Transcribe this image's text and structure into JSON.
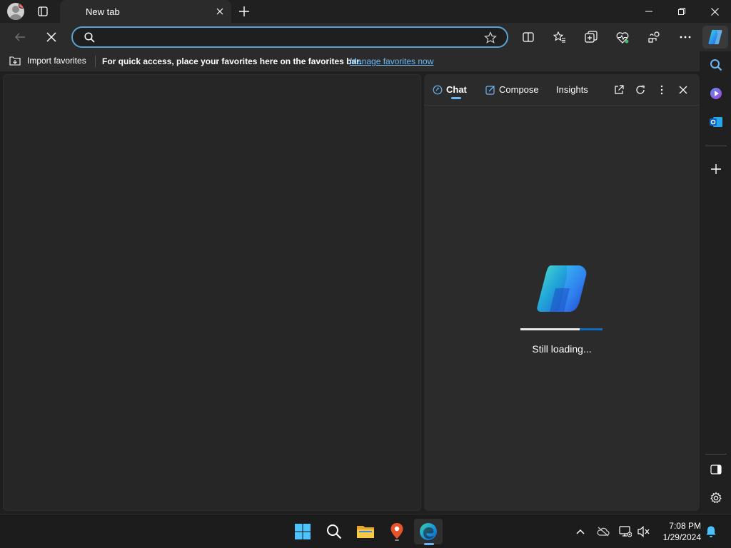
{
  "browser": {
    "tab": {
      "title": "New tab"
    },
    "address_bar": {
      "value": "",
      "placeholder": ""
    }
  },
  "favorites_bar": {
    "import_label": "Import favorites",
    "message": "For quick access, place your favorites here on the favorites bar.",
    "manage_link": "Manage favorites now"
  },
  "copilot_panel": {
    "tabs": [
      {
        "label": "Chat",
        "active": true
      },
      {
        "label": "Compose",
        "active": false
      },
      {
        "label": "Insights",
        "active": false
      }
    ],
    "loading_text": "Still loading...",
    "progress_fraction": 0.72
  },
  "taskbar": {
    "time": "7:08 PM",
    "date": "1/29/2024"
  },
  "colors": {
    "accent": "#6cb6f5",
    "address_border": "#5aa3d6",
    "background": "#1f1f1f",
    "panel": "#2b2b2b"
  },
  "icons": {
    "titlebar": [
      "profile-icon",
      "tab-actions-icon",
      "close-icon",
      "plus-icon",
      "minimize-icon",
      "restore-icon",
      "close-icon"
    ],
    "toolbar": [
      "back-arrow-icon",
      "stop-loading-icon",
      "search-icon",
      "star-icon",
      "split-screen-icon",
      "favorites-icon",
      "collections-icon",
      "browser-essentials-icon",
      "extensions-icon",
      "more-icon",
      "copilot-icon"
    ],
    "sidebar": [
      "search-icon",
      "copilot-icon",
      "outlook-icon",
      "plus-icon",
      "sidebar-toggle-icon",
      "settings-gear-icon"
    ],
    "taskbar": [
      "windows-start-icon",
      "search-icon",
      "file-explorer-icon",
      "maps-pin-icon",
      "edge-icon",
      "chevron-up-icon",
      "onedrive-offline-icon",
      "network-icon",
      "volume-muted-icon",
      "notification-bell-icon"
    ]
  }
}
